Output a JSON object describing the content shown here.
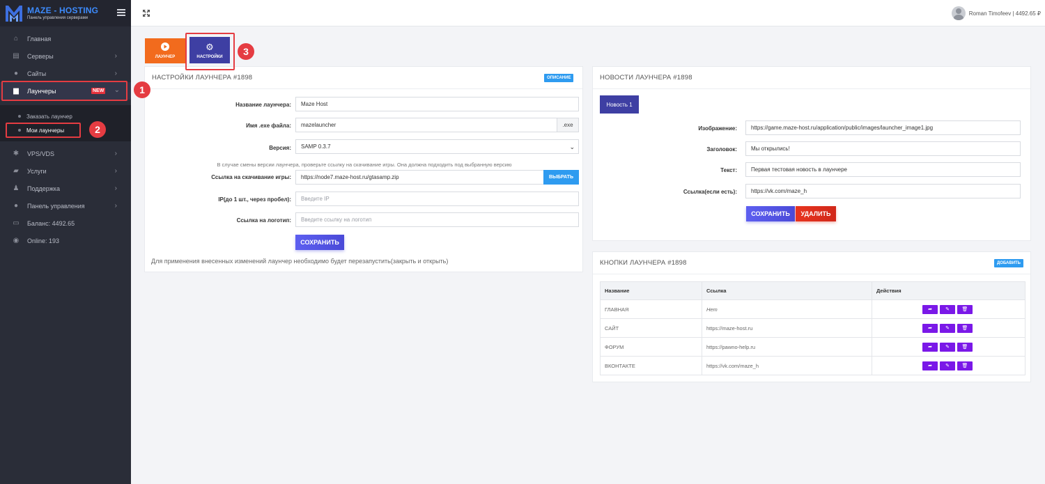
{
  "brand": {
    "title": "MAZE - HOSTING",
    "subtitle": "Панель управления серверами"
  },
  "sidebar": {
    "items": [
      {
        "label": "Главная",
        "icon": "home-icon"
      },
      {
        "label": "Серверы",
        "icon": "server-icon"
      },
      {
        "label": "Сайты",
        "icon": "globe-icon"
      },
      {
        "label": "Лаунчеры",
        "icon": "briefcase-icon",
        "badge": "NEW"
      },
      {
        "label": "VPS/VDS",
        "icon": "asterisk-icon"
      },
      {
        "label": "Услуги",
        "icon": "folder-icon"
      },
      {
        "label": "Поддержка",
        "icon": "users-icon"
      },
      {
        "label": "Панель управления",
        "icon": "globe-icon"
      },
      {
        "label": "Баланс: 4492.65",
        "icon": "card-icon"
      },
      {
        "label": "Online: 193",
        "icon": "eye-icon"
      }
    ],
    "submenu": [
      {
        "label": "Заказать лаунчер"
      },
      {
        "label": "Мои лаунчеры"
      }
    ]
  },
  "callouts": [
    "1",
    "2",
    "3"
  ],
  "header": {
    "user": "Roman Timofeev | 4492.65 ₽"
  },
  "tabs": {
    "launcher": "ЛАУНЧЕР",
    "settings": "НАСТРОЙКИ"
  },
  "settings": {
    "title": "НАСТРОЙКИ ЛАУНЧЕРА #1898",
    "desc_button": "ОПИСАНИЕ",
    "name_label": "Название лаунчера:",
    "name_value": "Maze Host",
    "exe_label": "Имя .exe файла:",
    "exe_value": "mazelauncher",
    "exe_suffix": ".exe",
    "version_label": "Версия:",
    "version_value": "SAMP 0.3.7",
    "version_note": "В случае смены версии лаунчера, проверьте ссылку на скачивание игры. Она должна подходить под выбранную версию",
    "download_label": "Ссылка на скачивание игры:",
    "download_value": "https://node7.maze-host.ru/gtasamp.zip",
    "choose_button": "ВЫБРАТЬ",
    "ip_label": "IP(до 1 шт., через пробел):",
    "ip_placeholder": "Введите IP",
    "logo_label": "Ссылка на логотип:",
    "logo_placeholder": "Введите ссылку на логотип",
    "save_button": "СОХРАНИТЬ",
    "footer_note": "Для применения внесенных изменений лаунчер необходимо будет перезапустить(закрыть и открыть)"
  },
  "news": {
    "title": "НОВОСТИ ЛАУНЧЕРА #1898",
    "tab": "Новость 1",
    "image_label": "Изображение:",
    "image_value": "https://game.maze-host.ru/application/public/images/launcher_image1.jpg",
    "heading_label": "Заголовок:",
    "heading_value": "Мы открылись!",
    "text_label": "Текст:",
    "text_value": "Первая тестовая новость в лаунчере",
    "link_label": "Ссылка(если есть):",
    "link_value": "https://vk.com/maze_h",
    "save_button": "СОХРАНИТЬ",
    "delete_button": "УДАЛИТЬ"
  },
  "buttons": {
    "title": "КНОПКИ ЛАУНЧЕРА #1898",
    "add_button": "ДОБАВИТЬ",
    "columns": [
      "Название",
      "Ссылка",
      "Действия"
    ],
    "rows": [
      {
        "name": "ГЛАВНАЯ",
        "link": "Нет"
      },
      {
        "name": "САЙТ",
        "link": "https://maze-host.ru"
      },
      {
        "name": "ФОРУМ",
        "link": "https://pawno-help.ru"
      },
      {
        "name": "ВКОНТАКТЕ",
        "link": "https://vk.com/maze_h"
      }
    ]
  },
  "colors": {
    "accent": "#3e3fa3",
    "orange": "#f26b1d",
    "purple": "#7a18e8",
    "highlight": "#e53c42"
  }
}
